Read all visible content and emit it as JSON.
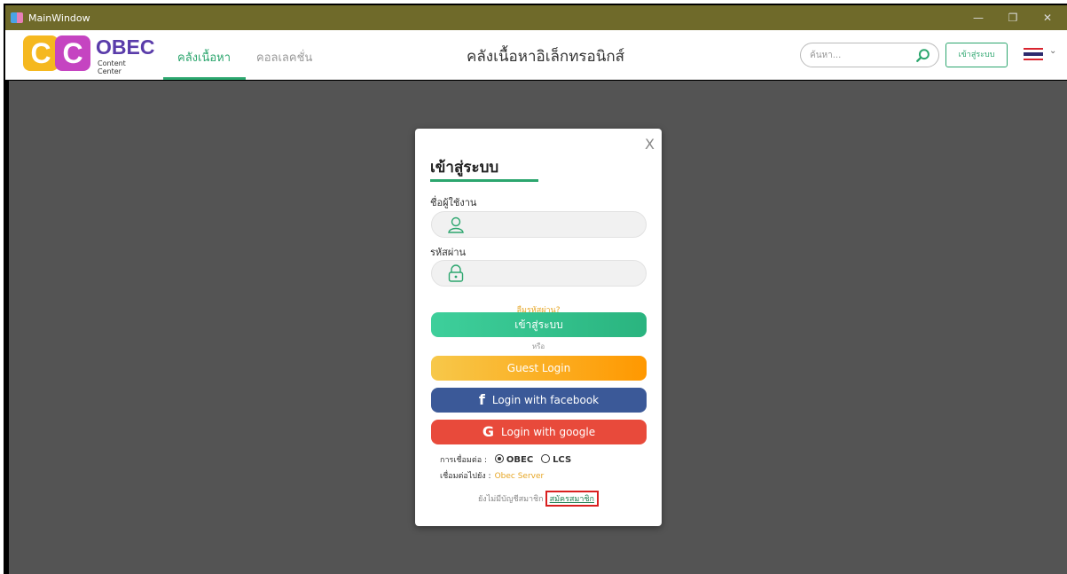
{
  "window": {
    "title": "MainWindow",
    "controls": [
      "—",
      "❐",
      "✕"
    ]
  },
  "header": {
    "logo_letters": [
      "C",
      "C"
    ],
    "logo_word": "OBEC",
    "logo_sub": "Content Center",
    "tabs": [
      {
        "label": "คลังเนื้อหา",
        "active": true
      },
      {
        "label": "คอลเลคชั่น",
        "active": false
      }
    ],
    "page_title": "คลังเนื้อหาอิเล็กทรอนิกส์",
    "search": {
      "placeholder": "ค้นหา...",
      "value": ""
    },
    "login_button": "เข้าสู่ระบบ",
    "language_flag": "thailand-flag",
    "colors": {
      "accent": "#2ca66e",
      "titlebar": "#6f6a2a",
      "background": "#545454"
    }
  },
  "modal": {
    "close_label": "X",
    "heading": "เข้าสู่ระบบ",
    "username_label": "ชื่อผู้ใช้งาน",
    "username_value": "",
    "password_label": "รหัสผ่าน",
    "password_value": "",
    "forgot_password": "ลืมรหัสผ่าน?",
    "login_button": "เข้าสู่ระบบ",
    "or_text": "หรือ",
    "guest_button": "Guest Login",
    "facebook_button": "Login with facebook",
    "google_button": "Login with google",
    "connection_label": "การเชื่อมต่อ :",
    "connection_options": [
      {
        "label": "OBEC",
        "selected": true
      },
      {
        "label": "LCS",
        "selected": false
      }
    ],
    "server_label": "เชื่อมต่อไปยัง :",
    "server_value": "Obec Server",
    "no_account_text": "ยังไม่มีบัญชีสมาชิก",
    "register_link": "สมัครสมาชิก"
  }
}
